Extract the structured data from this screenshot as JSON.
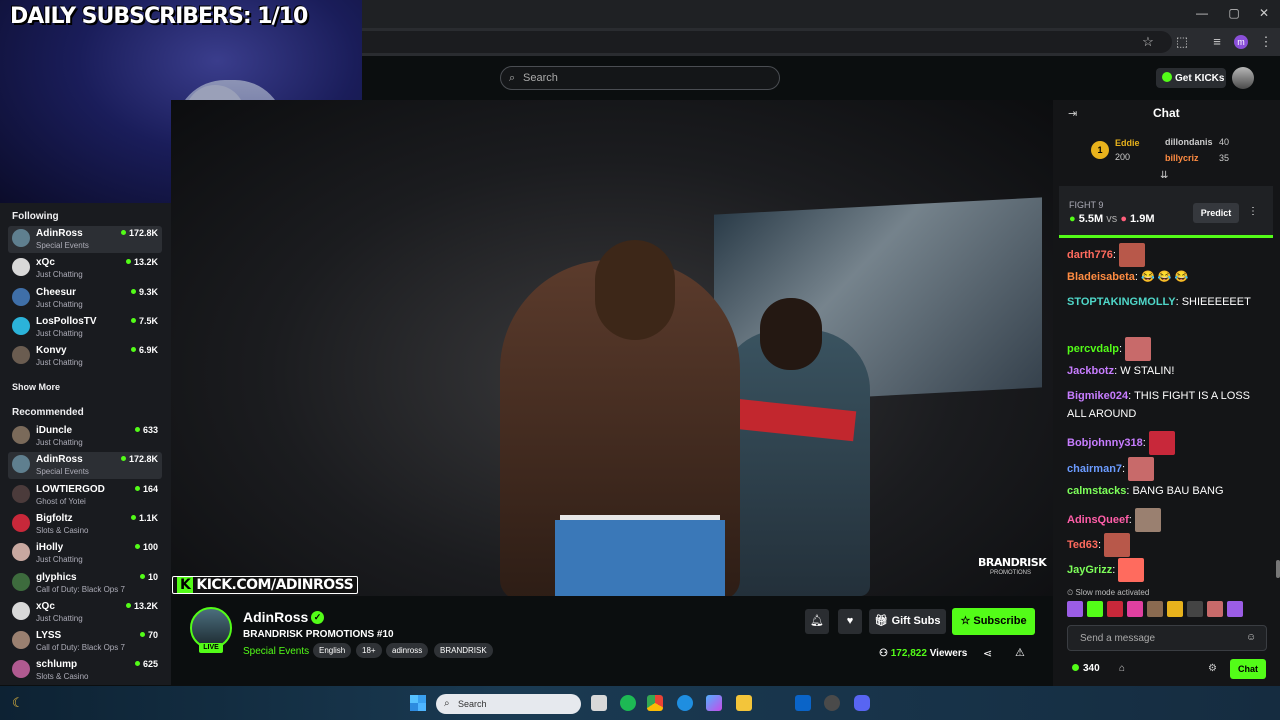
{
  "overlay": {
    "daily_subscribers": "DAILY SUBSCRIBERS: 1/10"
  },
  "browser": {
    "profile_initial": "m"
  },
  "header": {
    "search_placeholder": "Search",
    "get_kicks_label": "Get KICKs"
  },
  "sidebar": {
    "following_title": "Following",
    "following": [
      {
        "name": "AdinRoss",
        "category": "Special Events",
        "viewers": "172.8K",
        "active": true,
        "color": "#5f7f8f"
      },
      {
        "name": "xQc",
        "category": "Just Chatting",
        "viewers": "13.2K",
        "active": false,
        "color": "#d8d8d8"
      },
      {
        "name": "Cheesur",
        "category": "Just Chatting",
        "viewers": "9.3K",
        "active": false,
        "color": "#3f6fa8"
      },
      {
        "name": "LosPollosTV",
        "category": "Just Chatting",
        "viewers": "7.5K",
        "active": false,
        "color": "#2bb3d9"
      },
      {
        "name": "Konvy",
        "category": "Just Chatting",
        "viewers": "6.9K",
        "active": false,
        "color": "#6a5c50"
      }
    ],
    "show_more": "Show More",
    "recommended_title": "Recommended",
    "recommended": [
      {
        "name": "iDuncle",
        "category": "Just Chatting",
        "viewers": "633",
        "active": false,
        "color": "#7a6a5a"
      },
      {
        "name": "AdinRoss",
        "category": "Special Events",
        "viewers": "172.8K",
        "active": true,
        "color": "#5f7f8f"
      },
      {
        "name": "LOWTIERGOD",
        "category": "Ghost of Yotei",
        "viewers": "164",
        "active": false,
        "color": "#4b3b3b"
      },
      {
        "name": "Bigfoltz",
        "category": "Slots & Casino",
        "viewers": "1.1K",
        "active": false,
        "color": "#c8283a"
      },
      {
        "name": "iHolly",
        "category": "Just Chatting",
        "viewers": "100",
        "active": false,
        "color": "#c8a8a0"
      },
      {
        "name": "glyphics",
        "category": "Call of Duty: Black Ops 7",
        "viewers": "10",
        "active": false,
        "color": "#3d6b3d"
      },
      {
        "name": "xQc",
        "category": "Just Chatting",
        "viewers": "13.2K",
        "active": false,
        "color": "#d8d8d8"
      },
      {
        "name": "LYSS",
        "category": "Call of Duty: Black Ops 7",
        "viewers": "70",
        "active": false,
        "color": "#9a8070"
      },
      {
        "name": "schlump",
        "category": "Slots & Casino",
        "viewers": "625",
        "active": false,
        "color": "#b05a90"
      }
    ]
  },
  "video": {
    "watermark": "KICK.COM/ADINROSS",
    "watermark_k": "K",
    "brand": "BRANDRISK",
    "brand_sub": "PROMOTIONS"
  },
  "stream": {
    "streamer": "AdinRoss",
    "live": "LIVE",
    "title": "BRANDRISK PROMOTIONS #10",
    "category": "Special Events",
    "tags": [
      "English",
      "18+",
      "adinross",
      "BRANDRISK"
    ],
    "gift_subs": "Gift Subs",
    "subscribe": "Subscribe",
    "viewers_count": "172,822",
    "viewers_label": "Viewers"
  },
  "chat": {
    "title": "Chat",
    "leaderboard": {
      "rank": "1",
      "first_name": "Eddie",
      "first_value": "200",
      "second_name": "dillondanis",
      "second_value": "40",
      "third_name": "billycriz",
      "third_value": "35"
    },
    "prediction": {
      "label": "FIGHT 9",
      "a": "5.5M",
      "vs": "vs",
      "b": "1.9M",
      "button": "Predict"
    },
    "messages": [
      {
        "user": "darth776",
        "color": "#ff6b5e",
        "text": ""
      },
      {
        "user": "Bladeisabeta",
        "color": "#ff8c42",
        "text": "😂 😂 😂"
      },
      {
        "user": "STOPTAKINGMOLLY",
        "color": "#4fd6c8",
        "text": "SHIEEEEEET"
      },
      {
        "user": "percvdalp",
        "color": "#53fc18",
        "text": ""
      },
      {
        "user": "Jackbotz",
        "color": "#c77dff",
        "text": "W STALIN!"
      },
      {
        "user": "Bigmike024",
        "color": "#c77dff",
        "text": "THIS FIGHT IS A LOSS ALL AROUND"
      },
      {
        "user": "Bobjohnny318",
        "color": "#c77dff",
        "text": ""
      },
      {
        "user": "chairman7",
        "color": "#6b9bff",
        "text": ""
      },
      {
        "user": "calmstacks",
        "color": "#7dff5a",
        "text": "BANG BAU BANG"
      },
      {
        "user": "AdinsQueef",
        "color": "#ff5ea8",
        "text": ""
      },
      {
        "user": "Ted63",
        "color": "#ff6b5e",
        "text": ""
      },
      {
        "user": "JayGrizz",
        "color": "#7dff5a",
        "text": ""
      }
    ],
    "slow_mode": "Slow mode activated",
    "send_placeholder": "Send a message",
    "kicks": "340",
    "chat_button": "Chat"
  },
  "taskbar": {
    "search_placeholder": "Search"
  }
}
